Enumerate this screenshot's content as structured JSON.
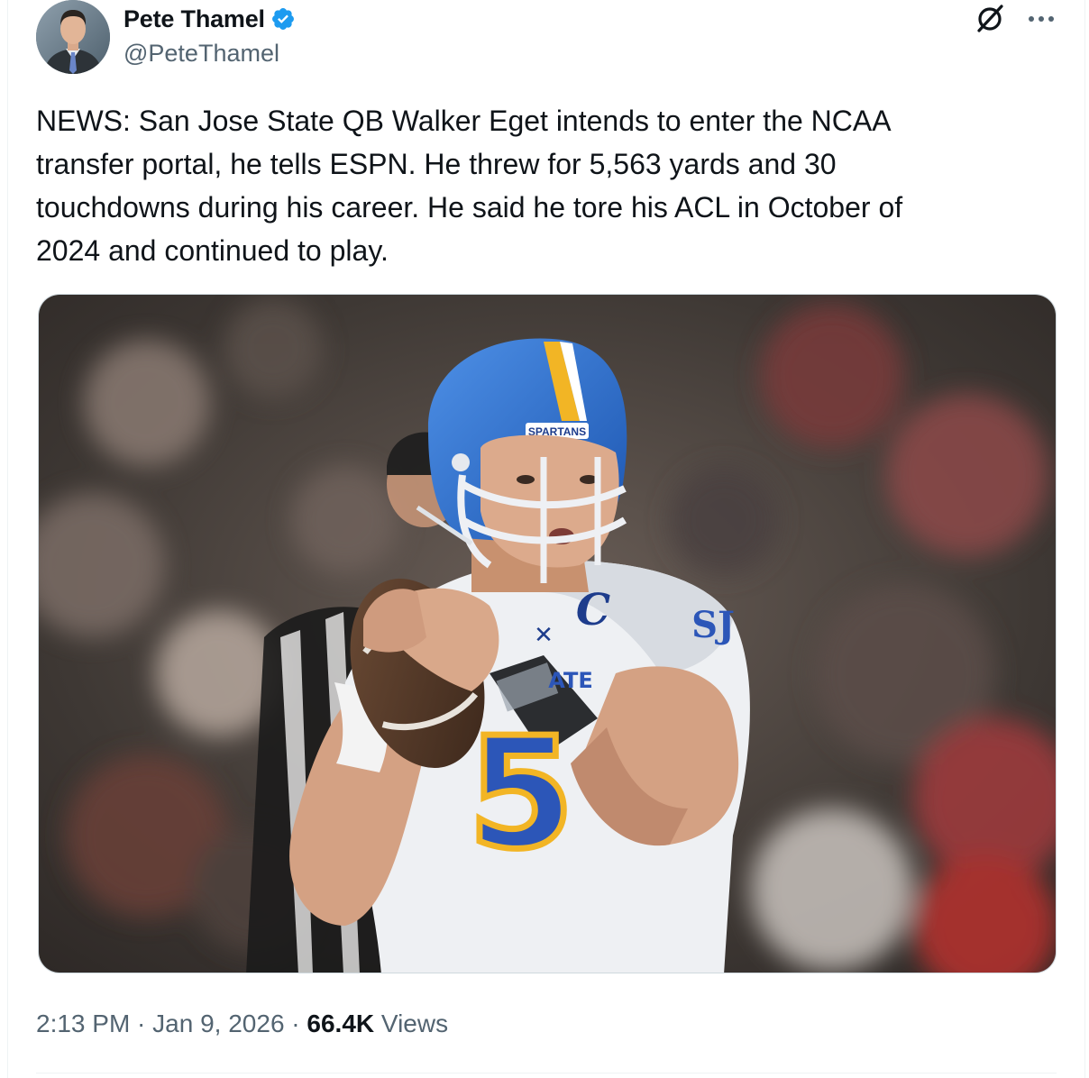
{
  "author": {
    "display_name": "Pete Thamel",
    "handle": "@PeteThamel",
    "verified": true,
    "verified_color": "#1d9bf0"
  },
  "header_actions": {
    "grok_icon": "grok-slash-circle-icon",
    "more_icon": "more-horizontal-icon"
  },
  "tweet": {
    "text": "NEWS: San Jose State QB Walker Eget intends to enter the NCAA\ntransfer portal, he tells ESPN. He threw for 5,563 yards and 30\ntouchdowns during his career. He said he tore his ACL in October of\n2024 and continued to play."
  },
  "media": {
    "type": "photo",
    "helmet_text": "SPARTANS",
    "jersey_number": "5",
    "jersey_patch": "C",
    "jersey_text": "ATE",
    "sleeve_logo": "SJ",
    "colors": {
      "helmet_blue": "#2a6fd0",
      "gold": "#f2b525",
      "jersey_white": "#eef0f3",
      "navy": "#1d3c8c"
    }
  },
  "meta": {
    "time": "2:13 PM",
    "separator": " · ",
    "date": "Jan 9, 2026",
    "views_count": "66.4K",
    "views_label": " Views"
  },
  "theme": {
    "text_primary": "#0f1419",
    "text_secondary": "#536471",
    "border": "#eff3f4"
  }
}
